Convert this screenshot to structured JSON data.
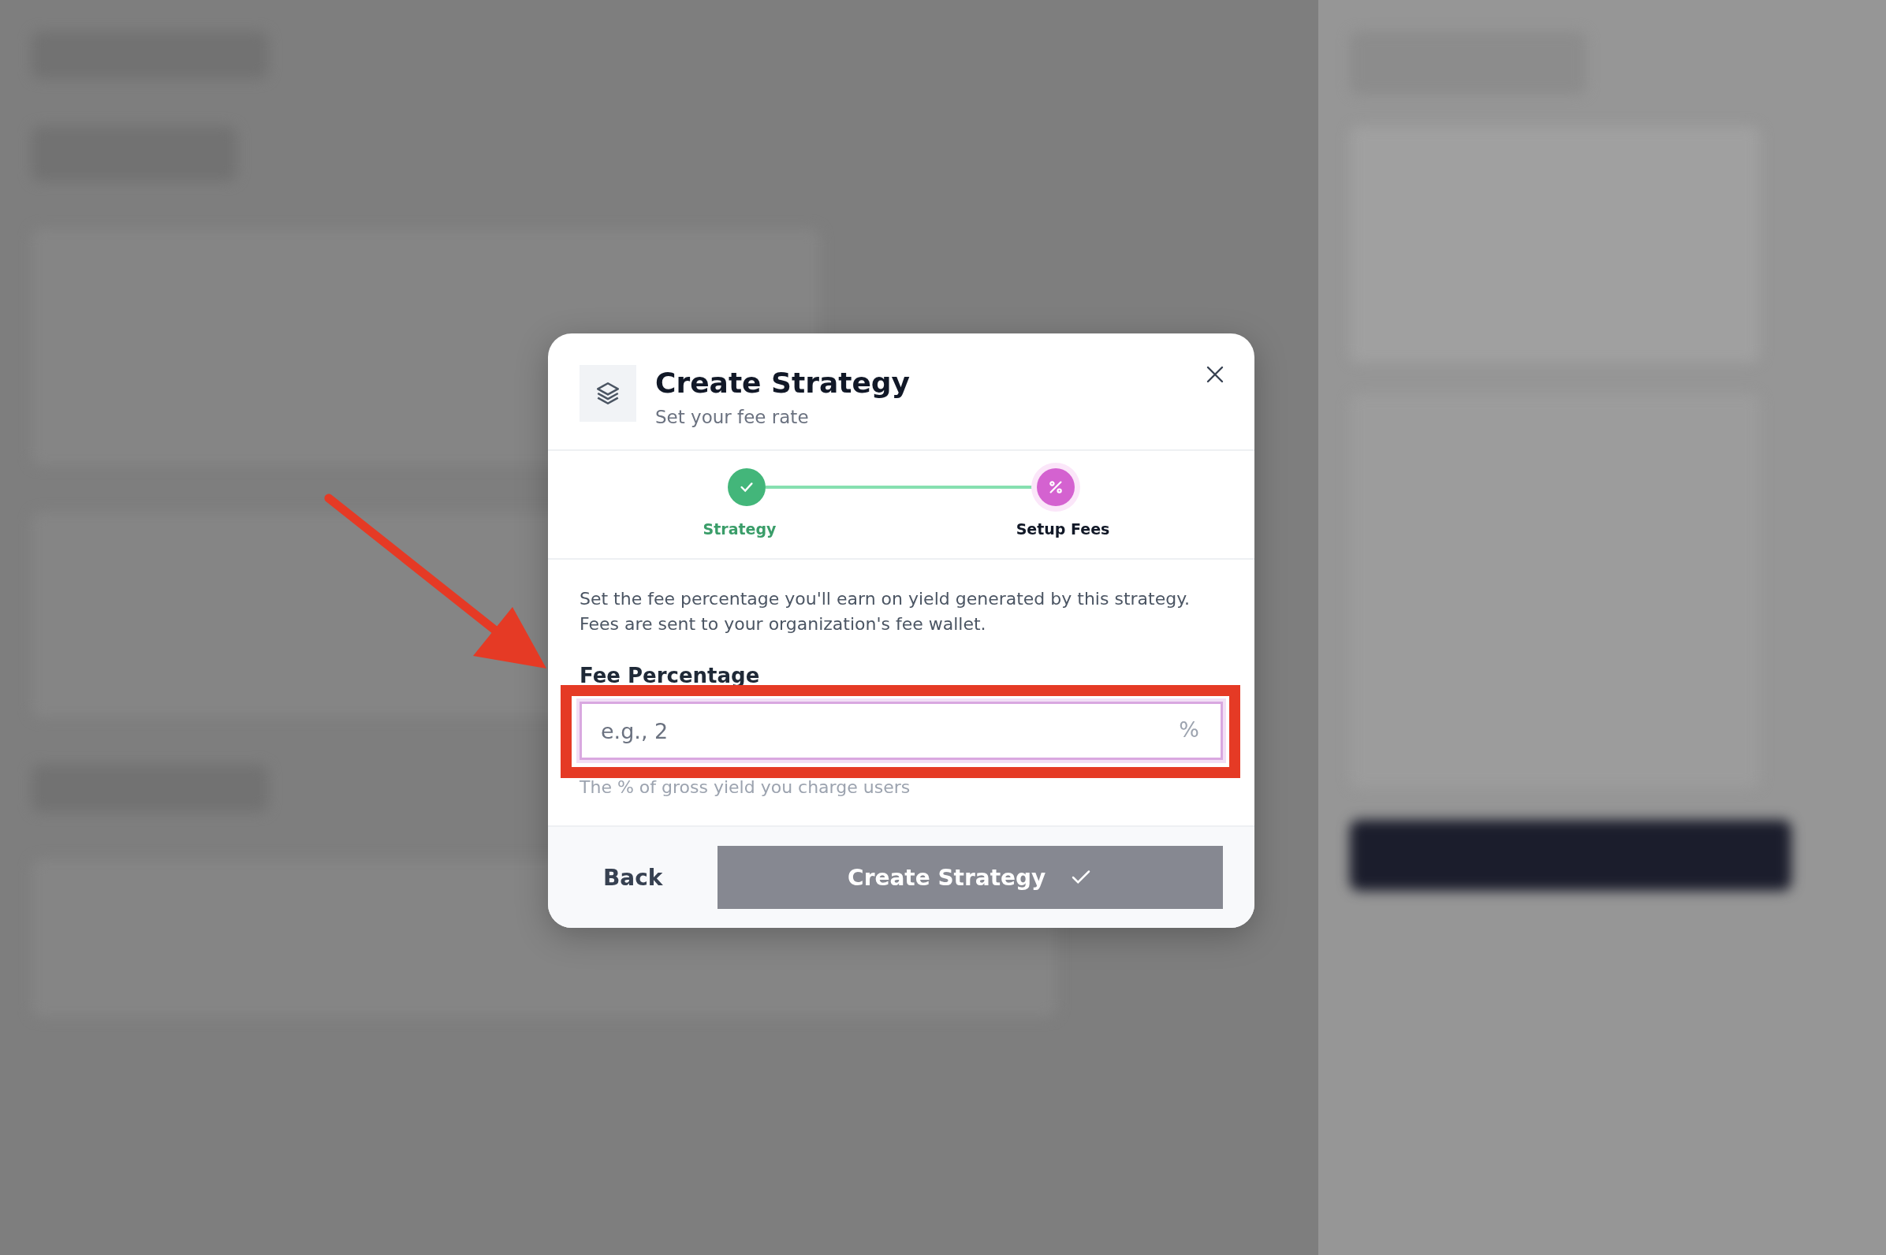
{
  "dialog": {
    "title": "Create Strategy",
    "subtitle": "Set your fee rate",
    "steps": [
      {
        "label": "Strategy",
        "completed": true,
        "selected": false
      },
      {
        "label": "Setup Fees",
        "completed": false,
        "selected": true
      }
    ],
    "description": "Set the fee percentage you'll earn on yield generated by this strategy. Fees are sent to your organization's fee wallet.",
    "field": {
      "label": "Fee Percentage",
      "placeholder": "e.g., 2",
      "suffix": "%",
      "help": "The % of gross yield you charge users",
      "focused": true
    },
    "buttons": {
      "back": "Back",
      "submit": {
        "label": "Create Strategy",
        "disabled": true
      }
    }
  }
}
